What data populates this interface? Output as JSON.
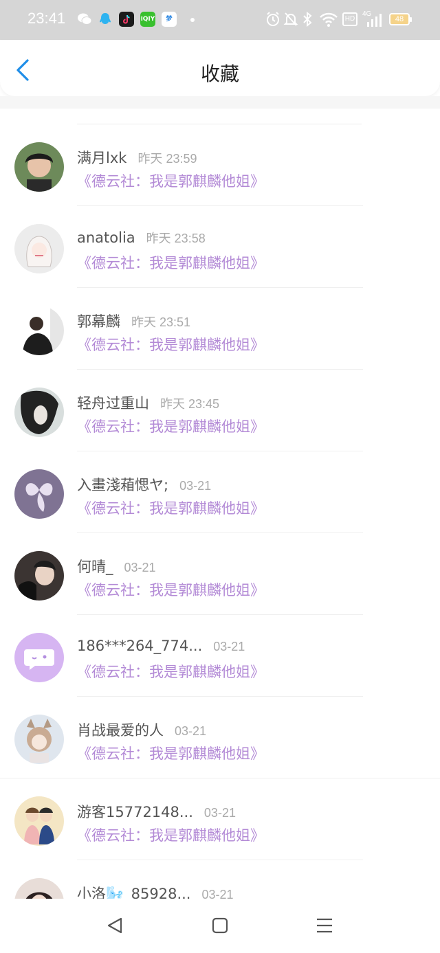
{
  "status_bar": {
    "time": "23:41",
    "apps": [
      "wechat-icon",
      "qq-icon",
      "tiktok-icon",
      "iqiyi-icon",
      "mengzhi-icon"
    ],
    "network_badge": "HD",
    "signal_label": "4G",
    "battery": "48"
  },
  "header": {
    "title": "收藏",
    "back_icon": "chevron-left-icon"
  },
  "colors": {
    "accent": "#1f8ee8",
    "book_title": "#b38ad6",
    "status_bar_bg": "#d6d6d6"
  },
  "favorites": [
    {
      "name": "满月lxk",
      "time": "昨天 23:59",
      "book": "《德云社：我是郭麒麟他姐》"
    },
    {
      "name": "anatolia",
      "time": "昨天 23:58",
      "book": "《德云社：我是郭麒麟他姐》"
    },
    {
      "name": "郭幕麟",
      "time": "昨天 23:51",
      "book": "《德云社：我是郭麒麟他姐》"
    },
    {
      "name": "轻舟过重山",
      "time": "昨天 23:45",
      "book": "《德云社：我是郭麒麟他姐》"
    },
    {
      "name": "入畫淺葙愢ヤ;",
      "time": "03-21",
      "book": "《德云社：我是郭麒麟他姐》"
    },
    {
      "name": "何晴_",
      "time": "03-21",
      "book": "《德云社：我是郭麒麟他姐》"
    },
    {
      "name": "186***264_774...",
      "time": "03-21",
      "book": "《德云社：我是郭麒麟他姐》"
    },
    {
      "name": "肖战最爱的人",
      "time": "03-21",
      "book": "《德云社：我是郭麒麟他姐》"
    },
    {
      "name": "游客15772148...",
      "time": "03-21",
      "book": "《德云社：我是郭麒麟他姐》"
    },
    {
      "name": "小洛🌬️_85928...",
      "time": "03-21",
      "book": ""
    }
  ],
  "nav_bar": {
    "back": "triangle-back-icon",
    "home": "square-home-icon",
    "menu": "lines-menu-icon"
  }
}
